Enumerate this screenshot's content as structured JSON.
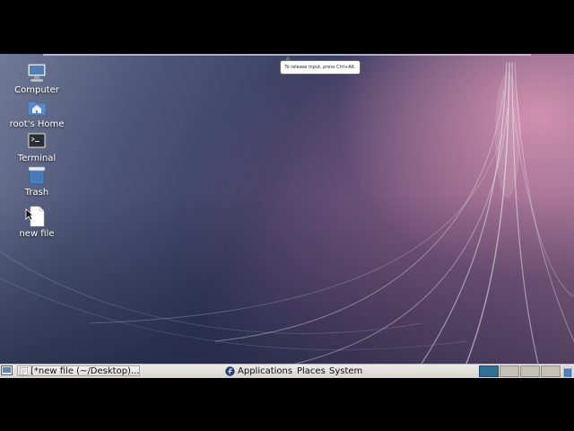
{
  "desktop": {
    "icons": [
      {
        "label": "Computer",
        "icon": "computer-icon"
      },
      {
        "label": "root's Home",
        "icon": "home-folder-icon"
      },
      {
        "label": "Terminal",
        "icon": "terminal-icon"
      },
      {
        "label": "Trash",
        "icon": "trash-icon"
      },
      {
        "label": "new file",
        "icon": "file-icon"
      }
    ]
  },
  "tooltip": {
    "text": "To release input, press Ctrl+Alt."
  },
  "panel": {
    "task_button": "[*new file (~/Desktop)...",
    "menus": {
      "applications": "Applications",
      "places": "Places",
      "system": "System"
    },
    "active_workspace": 1
  },
  "colors": {
    "panel_bg": "#e6e4dc",
    "active_workspace": "#2e6f93",
    "inactive_workspace": "#c3c0b5"
  }
}
